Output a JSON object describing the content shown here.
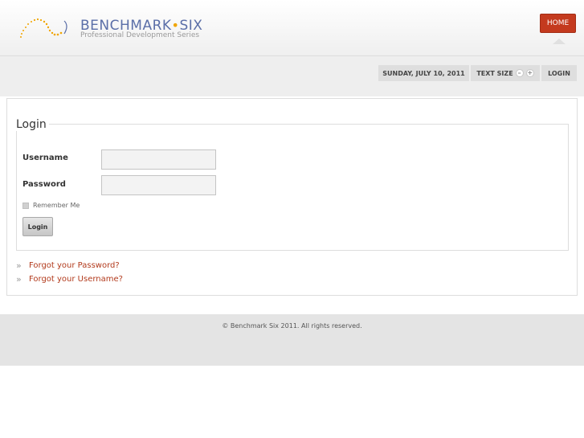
{
  "header": {
    "brand_name": "BENCHMARK",
    "brand_separator": "•",
    "brand_name_2": "SIX",
    "tagline": "Professional Development Series",
    "home_label": "HOME"
  },
  "utility": {
    "date": "SUNDAY, JULY 10, 2011",
    "text_size_label": "TEXT SIZE",
    "text_size_decrease": "–",
    "text_size_increase": "+",
    "login_label": "LOGIN"
  },
  "login": {
    "title": "Login",
    "username_label": "Username",
    "username_value": "",
    "password_label": "Password",
    "password_value": "",
    "remember_label": "Remember Me",
    "submit_label": "Login"
  },
  "links": {
    "chevron": "»",
    "forgot_password": "Forgot your Password?",
    "forgot_username": "Forgot your Username?"
  },
  "footer": {
    "copyright": "© Benchmark Six 2011. All rights reserved."
  },
  "colors": {
    "brand_blue": "#5b6fa8",
    "brand_orange": "#f0a500",
    "accent_red": "#c43a1e",
    "link_red": "#b23a1c"
  },
  "icons": {
    "logo": "dotted-swirl-logo",
    "text_decrease": "minus-circle-icon",
    "text_increase": "plus-circle-icon",
    "link_marker": "double-chevron-right-icon"
  }
}
